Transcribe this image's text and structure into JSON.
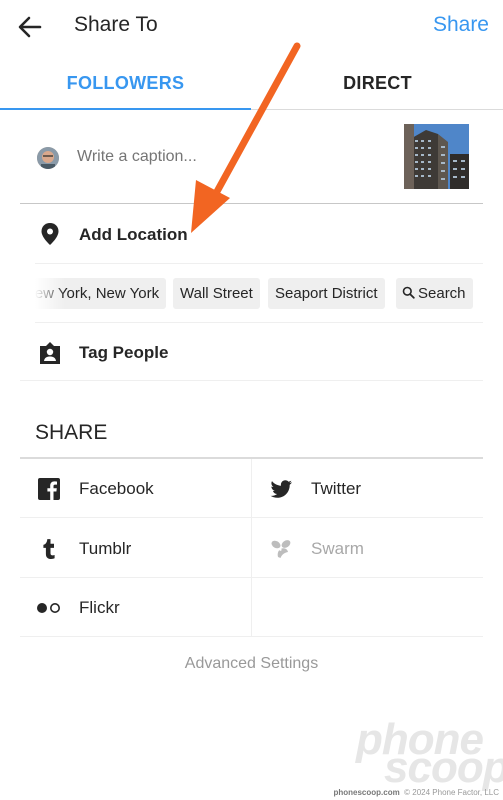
{
  "header": {
    "title": "Share To",
    "share_label": "Share"
  },
  "tabs": {
    "followers": "FOLLOWERS",
    "direct": "DIRECT"
  },
  "caption": {
    "placeholder": "Write a caption..."
  },
  "location": {
    "label": "Add Location",
    "suggestions": [
      "New York, New York",
      "Wall Street",
      "Seaport District"
    ],
    "search_label": "Search"
  },
  "tag_people": {
    "label": "Tag People"
  },
  "share": {
    "heading": "SHARE",
    "services": [
      {
        "label": "Facebook",
        "icon": "facebook-icon",
        "enabled": true
      },
      {
        "label": "Twitter",
        "icon": "twitter-icon",
        "enabled": true
      },
      {
        "label": "Tumblr",
        "icon": "tumblr-icon",
        "enabled": true
      },
      {
        "label": "Swarm",
        "icon": "swarm-icon",
        "enabled": false
      },
      {
        "label": "Flickr",
        "icon": "flickr-icon",
        "enabled": true
      }
    ]
  },
  "advanced_settings": "Advanced Settings",
  "watermark": {
    "brand_line1": "phone",
    "brand_line2": "scoop",
    "site": "phonescoop.com",
    "copyright": "© 2024 Phone Factor, LLC"
  },
  "colors": {
    "accent": "#3897f0",
    "annotation_arrow": "#f26522"
  }
}
